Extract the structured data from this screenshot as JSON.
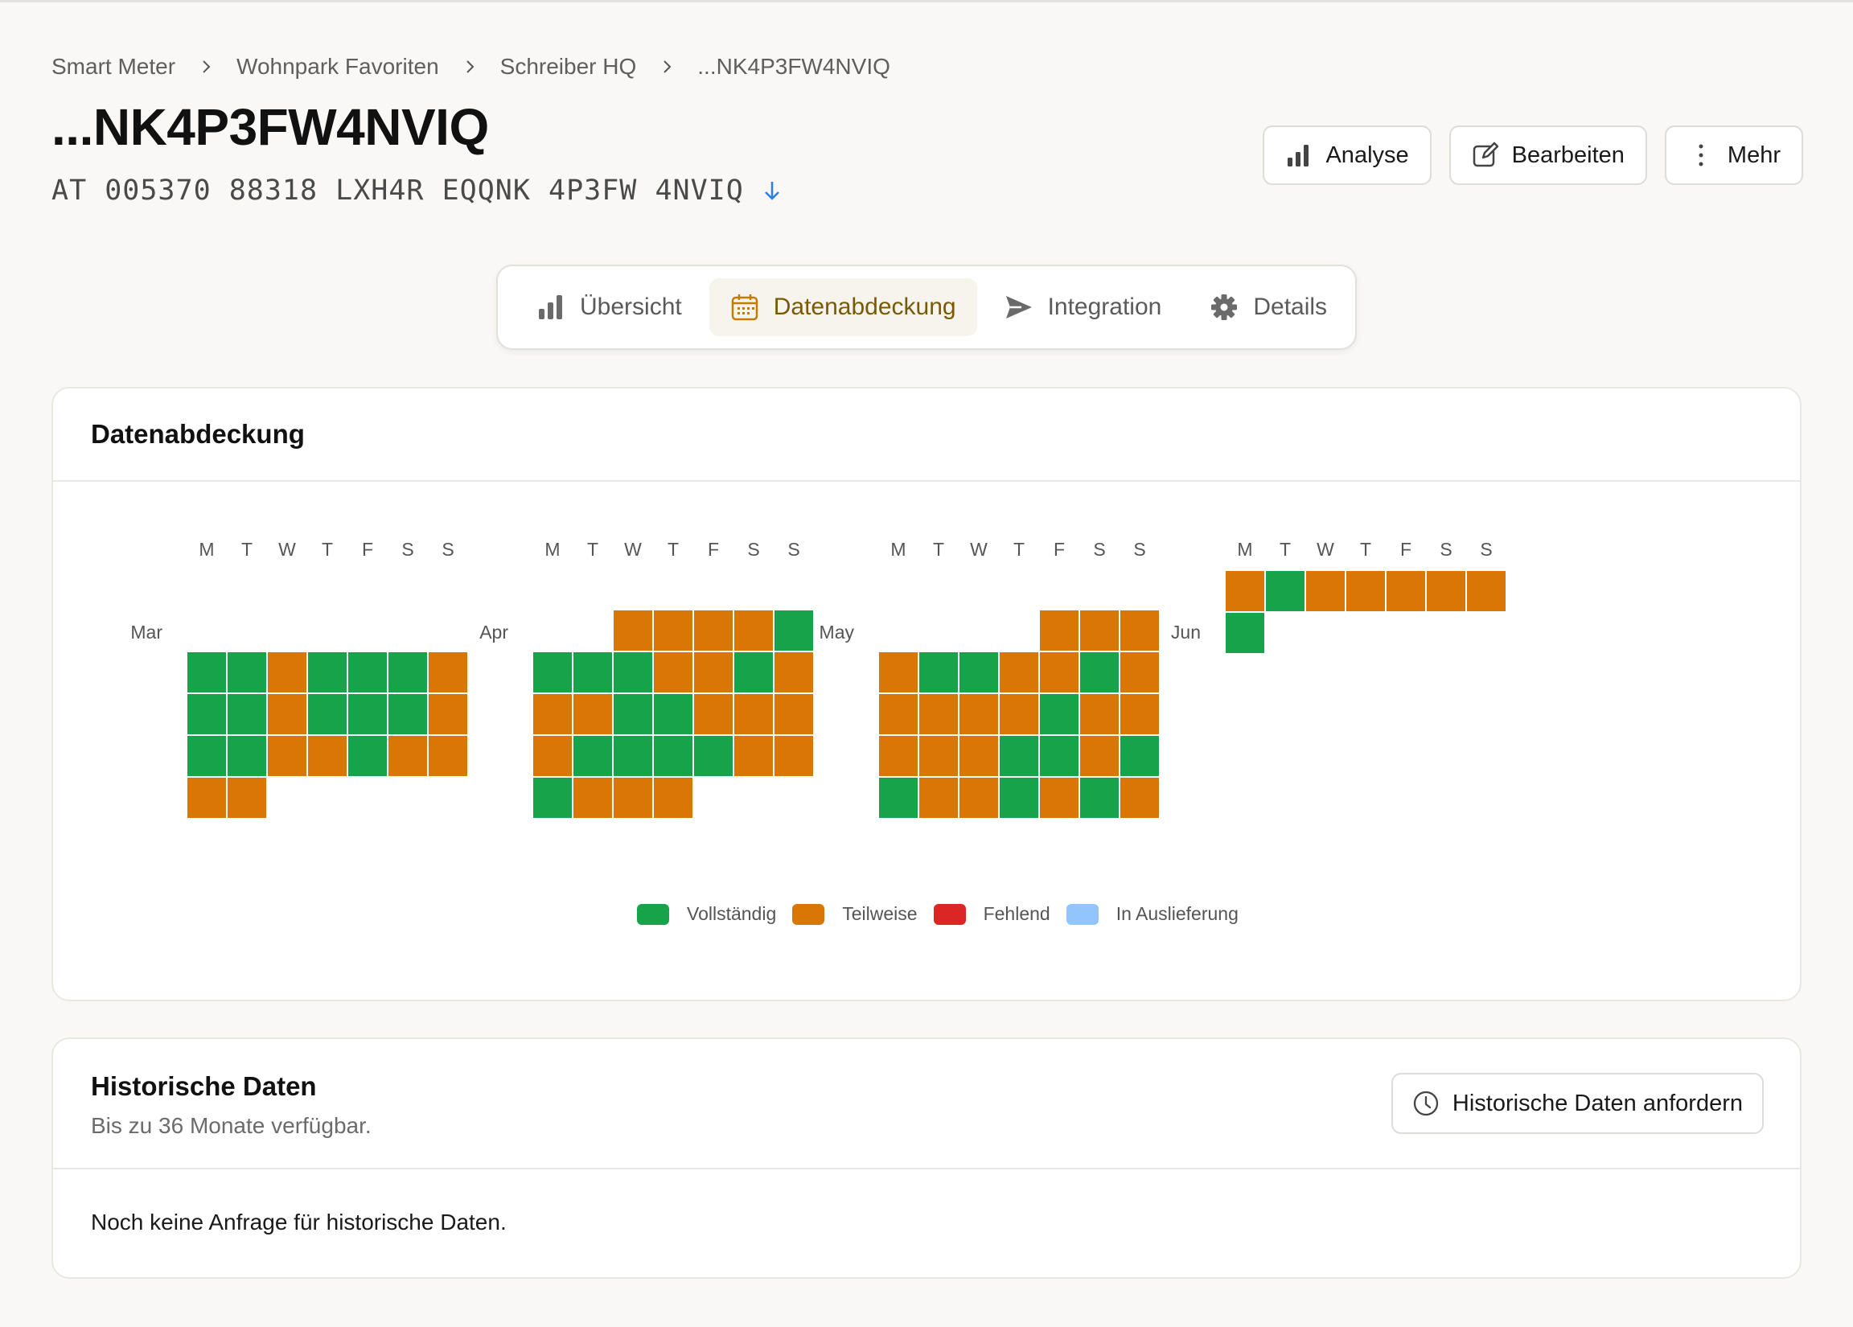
{
  "breadcrumb": [
    "Smart Meter",
    "Wohnpark Favoriten",
    "Schreiber HQ",
    "...NK4P3FW4NVIQ"
  ],
  "title": "...NK4P3FW4NVIQ",
  "meter_id": "AT 005370 88318 LXH4R EQQNK 4P3FW 4NVIQ",
  "actions": {
    "analyse": "Analyse",
    "edit": "Bearbeiten",
    "more": "Mehr"
  },
  "tabs": [
    {
      "label": "Übersicht",
      "icon": "bar-chart-icon",
      "active": false
    },
    {
      "label": "Datenabdeckung",
      "icon": "calendar-icon",
      "active": true
    },
    {
      "label": "Integration",
      "icon": "send-icon",
      "active": false
    },
    {
      "label": "Details",
      "icon": "gear-icon",
      "active": false
    }
  ],
  "coverage": {
    "title": "Datenabdeckung",
    "weekdays": [
      "M",
      "T",
      "W",
      "T",
      "F",
      "S",
      "S"
    ],
    "colors": {
      "full": "#16a34a",
      "partial": "#d97706",
      "missing": "#dc2626",
      "delivery": "#93c5fd"
    },
    "months": [
      {
        "label": "Mar",
        "rows": [
          "FFPFFFP",
          "FFPFFFP",
          "FFPPFPP",
          "PP....."
        ]
      },
      {
        "label": "Apr",
        "rows": [
          "..PPPPF",
          "FFFPPFP",
          "PPFFPPP",
          "PFFFFPP",
          "FPPP..."
        ]
      },
      {
        "label": "May",
        "rows": [
          "....PPP",
          "PFFPPFP",
          "PPPPFPP",
          "PPPFFPF",
          "FPPFPFP"
        ]
      },
      {
        "label": "Jun",
        "rows": [
          "PFPPPPP",
          "F......"
        ]
      }
    ],
    "legend": [
      {
        "label": "Vollständig",
        "color": "#16a34a"
      },
      {
        "label": "Teilweise",
        "color": "#d97706"
      },
      {
        "label": "Fehlend",
        "color": "#dc2626"
      },
      {
        "label": "In Auslieferung",
        "color": "#93c5fd"
      }
    ]
  },
  "historic": {
    "title": "Historische Daten",
    "subtitle": "Bis zu 36 Monate verfügbar.",
    "button": "Historische Daten anfordern",
    "empty": "Noch keine Anfrage für historische Daten."
  }
}
